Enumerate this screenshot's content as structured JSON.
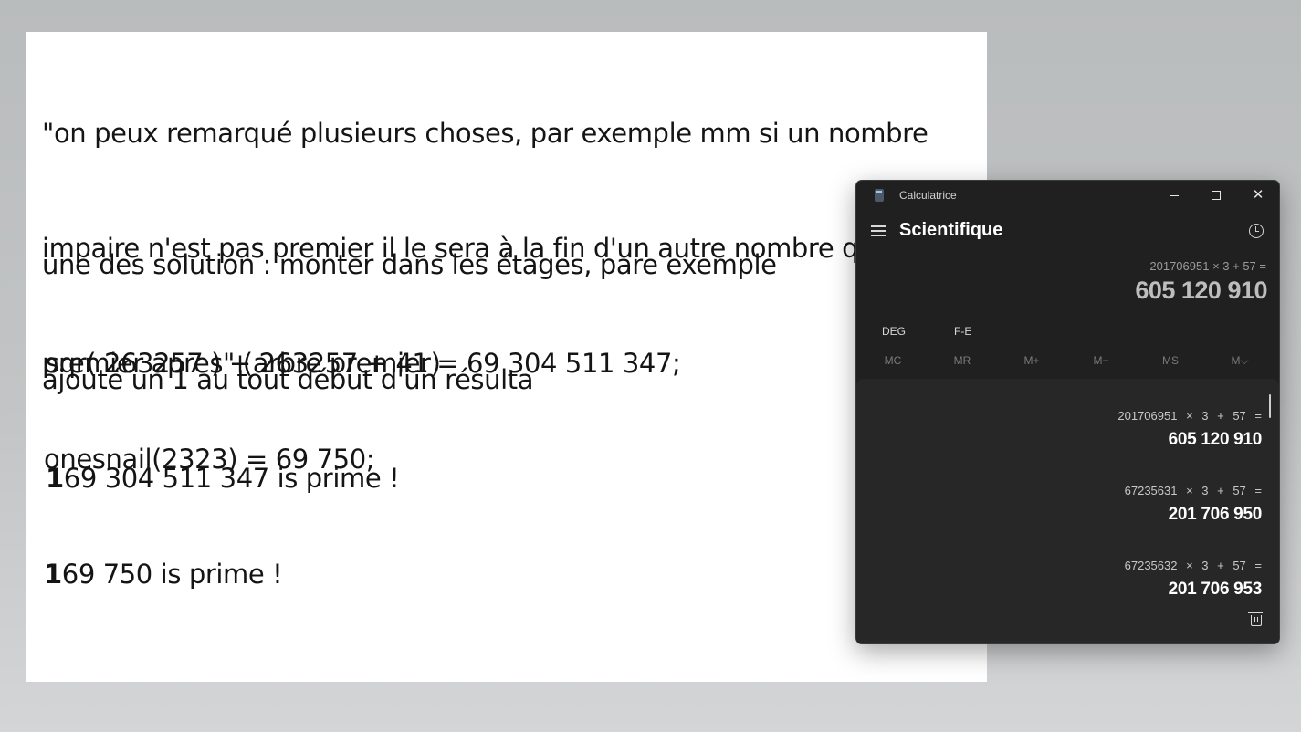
{
  "document": {
    "paragraph1": [
      "\"on peux remarqué plusieurs choses, par exemple mm si un nombre",
      "impaire n'est pas premier il le sera à la fin d'un autre nombre qui est lui",
      "premier apres\" (arbre premier)"
    ],
    "paragraph2": [
      "une des solution : monter dans les étages, pare exemple",
      "ajouté un 1 au tout début d'un résulta"
    ],
    "example1": {
      "equation": "sqr( 263257 ) + 263257 + 41 = 69 304 511 347;",
      "prefix": "1",
      "result_rest": "69 304 511 347 is prime !"
    },
    "example2": {
      "equation": "onesnail(2323) = 69 750;",
      "prefix": "1",
      "result_rest": "69 750 is prime !"
    }
  },
  "calculator": {
    "title": "Calculatrice",
    "mode": "Scientifique",
    "expression": "201706951 × 3 + 57 =",
    "result": "605 120 910",
    "options": [
      "DEG",
      "F-E"
    ],
    "memory": [
      "MC",
      "MR",
      "M+",
      "M−",
      "MS",
      "M⌵"
    ],
    "history": [
      {
        "expression": "201706951 × 3 + 57 =",
        "result": "605 120 910"
      },
      {
        "expression": "67235631 × 3 + 57 =",
        "result": "201 706 950"
      },
      {
        "expression": "67235632 × 3 + 57 =",
        "result": "201 706 953"
      }
    ],
    "icons": {
      "app": "calculator-icon",
      "menu": "hamburger-icon",
      "history": "history-icon",
      "delete": "trash-icon"
    }
  }
}
